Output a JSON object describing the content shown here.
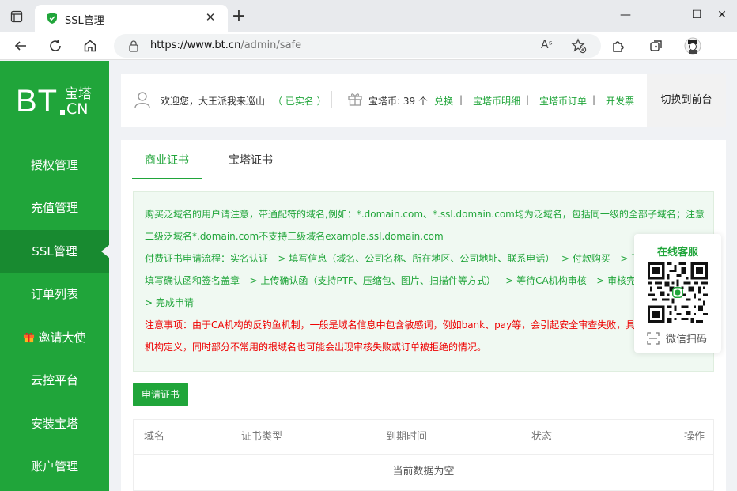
{
  "browser": {
    "tab_title": "SSL管理",
    "url_host": "https://www.bt.cn",
    "url_path": "/admin/safe",
    "reader_label": "Aˢ"
  },
  "logo": {
    "latin": "BT",
    "cn_top": "宝塔",
    "cn_bottom": "CN"
  },
  "sidebar": {
    "items": [
      {
        "label": "授权管理"
      },
      {
        "label": "充值管理"
      },
      {
        "label": "SSL管理",
        "active": true
      },
      {
        "label": "订单列表"
      },
      {
        "label": "邀请大使"
      },
      {
        "label": "云控平台"
      },
      {
        "label": "安装宝塔"
      },
      {
        "label": "账户管理"
      }
    ]
  },
  "header": {
    "welcome": "欢迎您，大王派我来巡山",
    "verified": "（ 已实名 ）",
    "coins": "宝塔币: 39 个",
    "links": [
      "兑换",
      "宝塔币明细",
      "宝塔币订单",
      "开发票"
    ],
    "switch": "切换到前台"
  },
  "tabs": [
    "商业证书",
    "宝塔证书"
  ],
  "notice": {
    "lines": [
      "购买泛域名的用户请注意，带通配符的域名,例如：*.domain.com、*.ssl.domain.com均为泛域名，包括同一级的全部子域名；注意",
      "二级泛域名*.domain.com不支持三级域名example.ssl.domain.com",
      "付费证书申请流程：实名认证 --> 填写信息（域名、公司名称、所在地区、公司地址、联系电话）--> 付款购买 --> 下",
      "填写确认函和签名盖章 --> 上传确认函（支持PTF、压缩包、图片、扫描件等方式） --> 等待CA机构审核 --> 审核完",
      "> 完成申请"
    ],
    "warning_lines": [
      "注意事项：由于CA机构的反钓鱼机制，一般是域名信息中包含敏感词，例如bank、pay等，会引起安全审查失败，具",
      "机构定义，同时部分不常用的根域名也可能会出现审核失败或订单被拒绝的情况。"
    ]
  },
  "apply_button": "申请证书",
  "table": {
    "columns": [
      "域名",
      "证书类型",
      "到期时间",
      "状态",
      "操作"
    ],
    "empty_text": "当前数据为空"
  },
  "customer_service": {
    "title": "在线客服",
    "scan": "微信扫码"
  },
  "colors": {
    "brand": "#20a53a",
    "brand_dark": "#188a30",
    "warning": "#e00000"
  }
}
